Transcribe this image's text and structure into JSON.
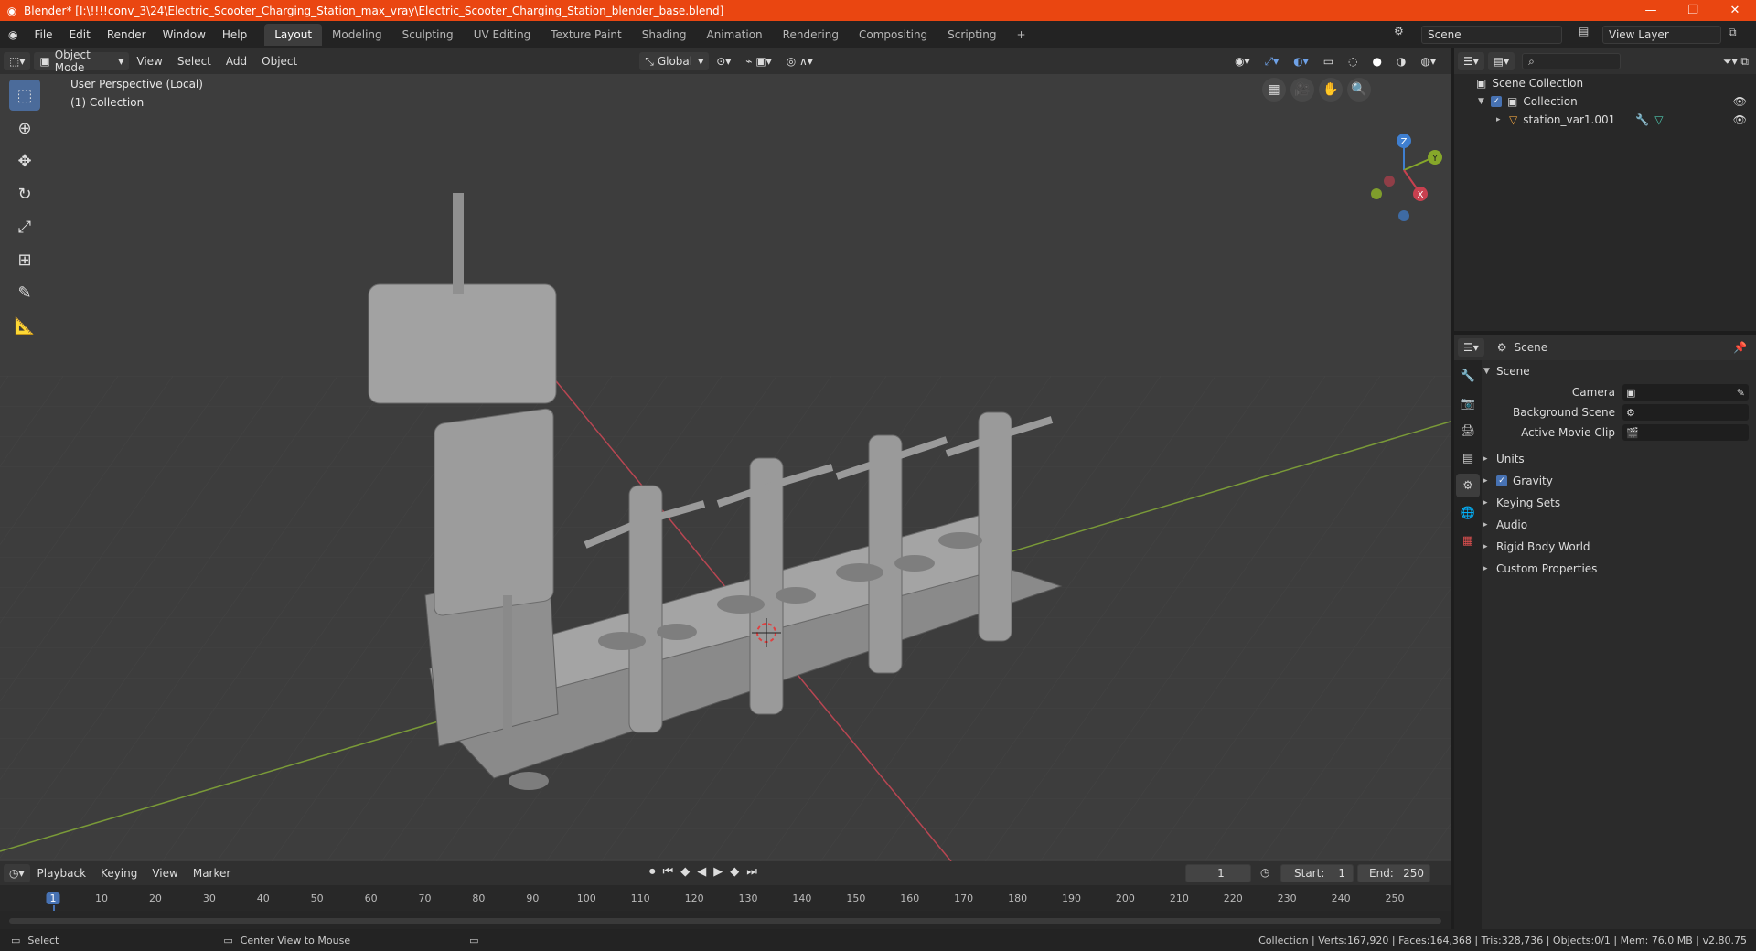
{
  "window": {
    "title": "Blender* [I:\\!!!!conv_3\\24\\Electric_Scooter_Charging_Station_max_vray\\Electric_Scooter_Charging_Station_blender_base.blend]",
    "minimize": "—",
    "maximize": "❐",
    "close": "✕"
  },
  "menu": [
    "File",
    "Edit",
    "Render",
    "Window",
    "Help"
  ],
  "workspaces": [
    "Layout",
    "Modeling",
    "Sculpting",
    "UV Editing",
    "Texture Paint",
    "Shading",
    "Animation",
    "Rendering",
    "Compositing",
    "Scripting"
  ],
  "workspace_add": "+",
  "scene_selector": "Scene",
  "view_layer": "View Layer",
  "viewport_header": {
    "mode": "Object Mode",
    "items": [
      "View",
      "Select",
      "Add",
      "Object"
    ],
    "transform": "Global"
  },
  "viewport": {
    "perspective": "User Perspective (Local)",
    "collection": "(1) Collection",
    "gizmo": {
      "x": "X",
      "y": "Y",
      "z": "Z"
    }
  },
  "timeline": {
    "items": [
      "Playback",
      "Keying",
      "View",
      "Marker"
    ],
    "current_frame": "1",
    "start_label": "Start:",
    "start": "1",
    "end_label": "End:",
    "end": "250",
    "ticks": [
      "1",
      "10",
      "20",
      "30",
      "40",
      "50",
      "60",
      "70",
      "80",
      "90",
      "100",
      "110",
      "120",
      "130",
      "140",
      "150",
      "160",
      "170",
      "180",
      "190",
      "200",
      "210",
      "220",
      "230",
      "240",
      "250"
    ]
  },
  "outliner": {
    "root": "Scene Collection",
    "collection": "Collection",
    "object": "station_var1.001"
  },
  "properties": {
    "header": "Scene",
    "panel_scene": "Scene",
    "camera_label": "Camera",
    "background_scene_label": "Background Scene",
    "active_movie_clip_label": "Active Movie Clip",
    "panels": [
      "Units",
      "Gravity",
      "Keying Sets",
      "Audio",
      "Rigid Body World",
      "Custom Properties"
    ]
  },
  "status": {
    "left": "Select",
    "middle": "Center View to Mouse",
    "right": "Collection | Verts:167,920 | Faces:164,368 | Tris:328,736 | Objects:0/1 | Mem: 76.0 MB | v2.80.75"
  },
  "colors": {
    "titlebar": "#ea4611",
    "accent": "#4772b3",
    "x_axis": "#c8404f",
    "y_axis": "#86a72a",
    "z_axis": "#3f7fd0"
  }
}
